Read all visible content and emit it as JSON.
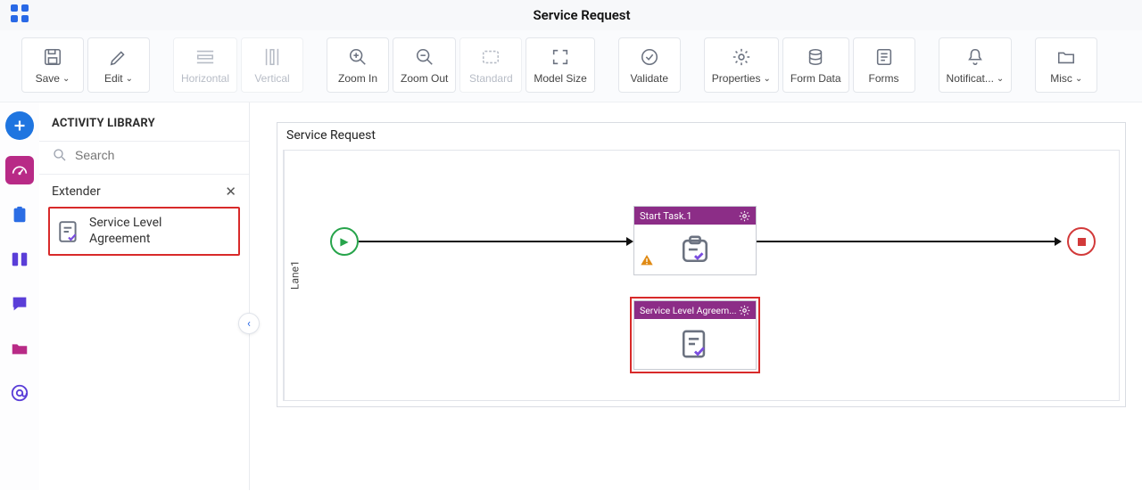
{
  "header": {
    "title": "Service Request"
  },
  "toolbar": {
    "save": "Save",
    "edit": "Edit",
    "horizontal": "Horizontal",
    "vertical": "Vertical",
    "zoom_in": "Zoom In",
    "zoom_out": "Zoom Out",
    "standard": "Standard",
    "model_size": "Model Size",
    "validate": "Validate",
    "properties": "Properties",
    "form_data": "Form Data",
    "forms": "Forms",
    "notifications": "Notificat...",
    "misc": "Misc"
  },
  "panel": {
    "title": "ACTIVITY LIBRARY",
    "search_placeholder": "Search",
    "category": "Extender",
    "item_line1": "Service Level",
    "item_line2": "Agreement"
  },
  "canvas": {
    "title": "Service Request",
    "lane": "Lane1",
    "task1": "Start Task.1",
    "task2": "Service Level Agreem..."
  }
}
